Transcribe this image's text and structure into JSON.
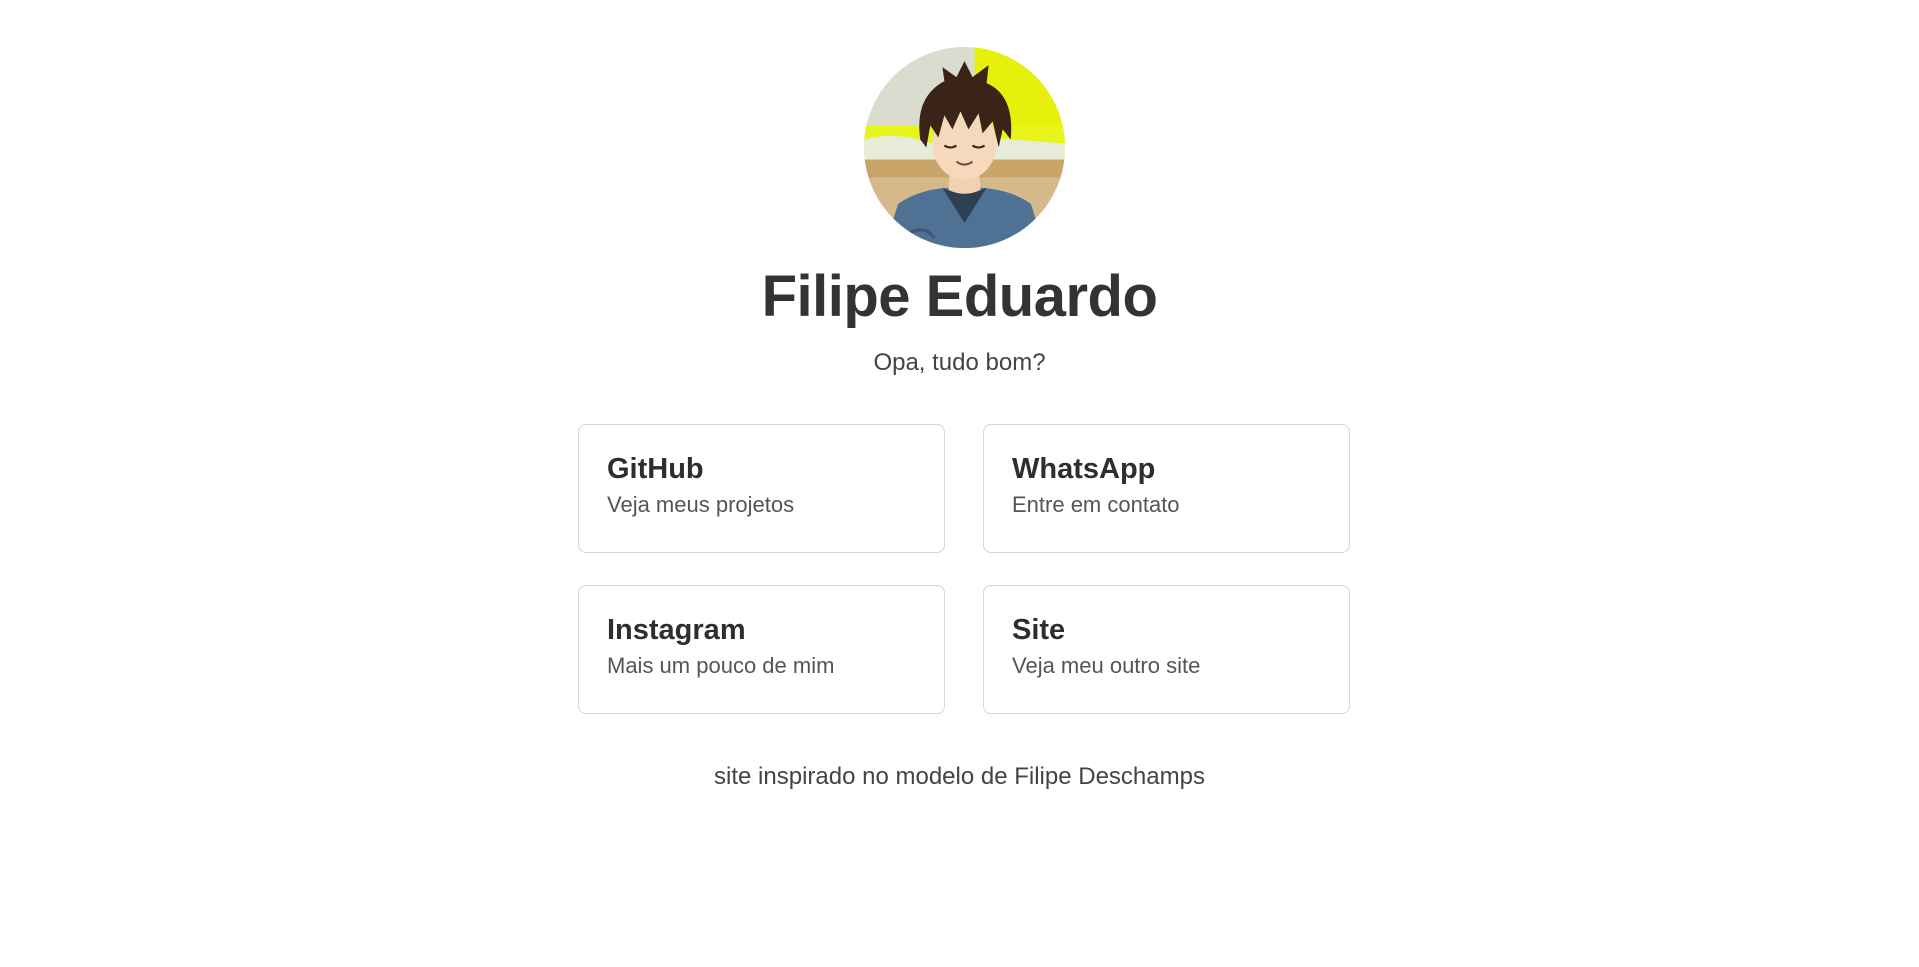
{
  "profile": {
    "name": "Filipe Eduardo",
    "greeting": "Opa, tudo bom?"
  },
  "links": [
    {
      "title": "GitHub",
      "description": "Veja meus projetos"
    },
    {
      "title": "WhatsApp",
      "description": "Entre em contato"
    },
    {
      "title": "Instagram",
      "description": "Mais um pouco de mim"
    },
    {
      "title": "Site",
      "description": "Veja meu outro site"
    }
  ],
  "footer": {
    "text": "site inspirado no modelo de Filipe Deschamps"
  },
  "colors": {
    "background": "#ffffff",
    "text": "#333333",
    "card_border": "#d5d5d5"
  }
}
